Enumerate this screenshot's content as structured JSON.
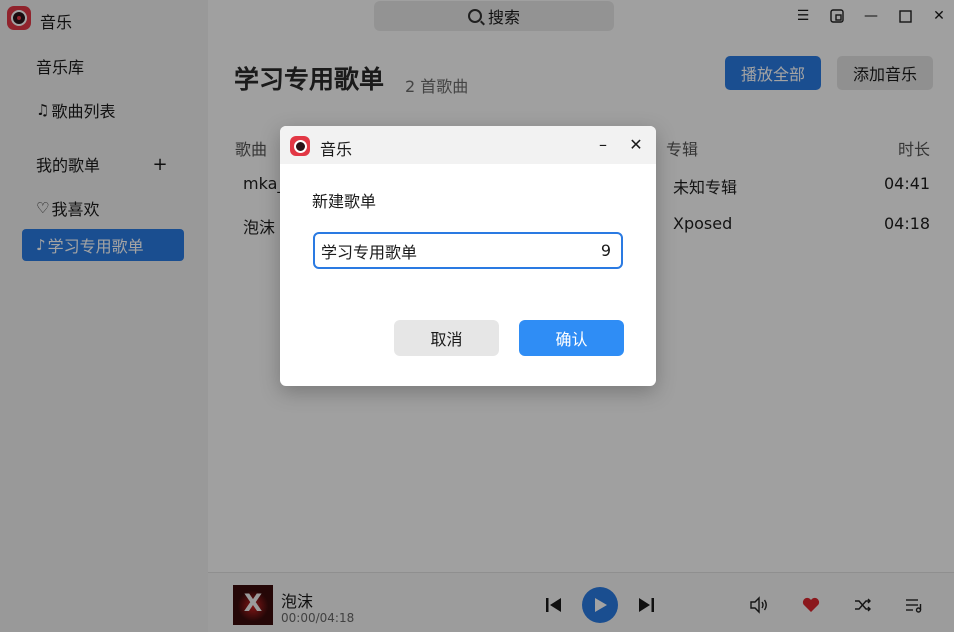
{
  "app": {
    "title": "音乐"
  },
  "search": {
    "label": "搜索"
  },
  "sidebar": {
    "library_header": "音乐库",
    "items": [
      {
        "label": "歌曲列表",
        "icon": "music-note-icon"
      }
    ],
    "playlists_header": "我的歌单",
    "playlists": [
      {
        "label": "我喜欢",
        "icon": "heart-icon"
      },
      {
        "label": "学习专用歌单",
        "icon": "playlist-icon",
        "active": true
      }
    ]
  },
  "main": {
    "title": "学习专用歌单",
    "count": "2 首歌曲",
    "play_all": "播放全部",
    "add_music": "添加音乐",
    "columns": {
      "song": "歌曲",
      "album": "专辑",
      "duration": "时长"
    },
    "rows": [
      {
        "song": "mka_",
        "album": "未知专辑",
        "duration": "04:41"
      },
      {
        "song": "泡沫",
        "album": "Xposed",
        "duration": "04:18"
      }
    ]
  },
  "player": {
    "title": "泡沫",
    "time": "00:00/04:18"
  },
  "dialog": {
    "title": "音乐",
    "label": "新建歌单",
    "input_value": "学习专用歌单",
    "char_count": "9",
    "cancel": "取消",
    "confirm": "确认"
  },
  "colors": {
    "accent": "#2a7ae2",
    "brand": "#e23845",
    "favorite": "#d9262e"
  }
}
